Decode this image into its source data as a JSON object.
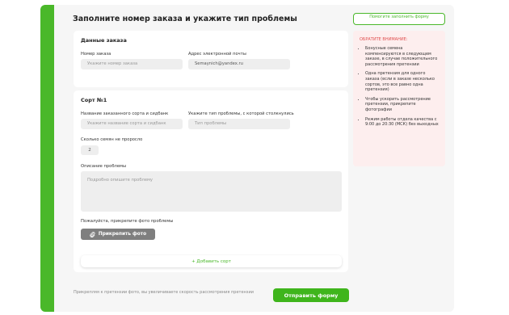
{
  "title": "Заполните номер заказа и укажите тип проблемы",
  "order": {
    "heading": "Данные заказа",
    "order_number_label": "Номер заказа",
    "order_number_placeholder": "Укажите номер заказа",
    "email_label": "Адрес электронной почты",
    "email_value": "Semaynich@yandex.ru"
  },
  "sort": {
    "heading": "Сорт №1",
    "name_label": "Название заказанного сорта и сидбанк",
    "name_placeholder": "Укажите название сорта и сидбанк",
    "problem_label": "Укажите тип проблемы, с которой столкнулись",
    "problem_placeholder": "Тип проблемы",
    "seeds_label": "Сколько семян не проросло",
    "seeds_value": "2",
    "description_label": "Описание проблемы",
    "description_placeholder": "Подробно опишите проблему",
    "photo_label": "Пожалуйста, прикрепите фото проблемы",
    "attach_button": "Прикрепить фото"
  },
  "add_sort": "+ Добавить сорт",
  "bottom_note": "Прикрепляя к претензии фото, вы увеличиваете скорость рассмотрения претензии",
  "submit_button": "Отправить форму",
  "help_button": "Помогите заполнить форму",
  "notice": {
    "title": "ОБРАТИТЕ ВНИМАНИЕ:",
    "items": [
      "Бонусные семена компенсируются в следующем заказе, в случае положительного рассмотрения претензии",
      "Одна претензия для одного заказа (если в заказе несколько сортов, это все равно одна претензия)",
      "Чтобы ускорить рассмотрение претензии, прикрепите фотографии",
      "Режим работы отдела качества с 9:00 до 20:30 (МСК) без выходных"
    ]
  },
  "colors": {
    "accent": "#4ab82a",
    "notice_bg": "#fdeeee",
    "notice_title": "#e05050"
  },
  "icons": {
    "attach": "paperclip-icon"
  }
}
